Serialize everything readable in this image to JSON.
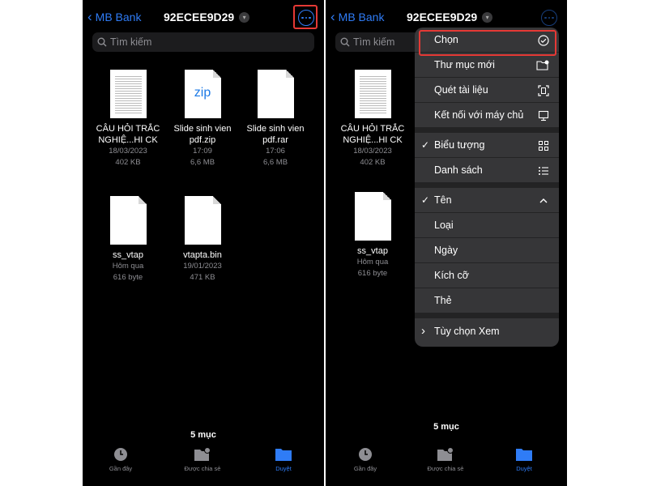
{
  "colors": {
    "accent": "#2f7cf6",
    "highlight": "#e53935",
    "background": "#000000"
  },
  "nav": {
    "back_label": "MB Bank",
    "title": "92ECEE9D29"
  },
  "search": {
    "placeholder": "Tìm kiếm"
  },
  "files": [
    {
      "name1": "CÂU HỎI TRẮC",
      "name2": "NGHIỆ...HI CK",
      "date": "18/03/2023",
      "size": "402 KB",
      "icon": "document-thumbnail"
    },
    {
      "name1": "Slide sinh vien",
      "name2": "pdf.zip",
      "date": "17:09",
      "size": "6,6 MB",
      "icon": "zip-icon",
      "label": "zip"
    },
    {
      "name1": "Slide sinh vien",
      "name2": "pdf.rar",
      "date": "17:06",
      "size": "6,6 MB",
      "icon": "blank-file-icon"
    },
    {
      "name1": "ss_vtap",
      "name2": "",
      "date": "Hôm qua",
      "size": "616 byte",
      "icon": "blank-file-icon"
    },
    {
      "name1": "vtapta.bin",
      "name2": "",
      "date": "19/01/2023",
      "size": "471 KB",
      "icon": "blank-file-icon"
    }
  ],
  "item_count": "5 mục",
  "tabs": [
    {
      "label": "Gần đây",
      "icon": "clock-icon"
    },
    {
      "label": "Được chia sẻ",
      "icon": "shared-folder-icon"
    },
    {
      "label": "Duyệt",
      "icon": "folder-icon"
    }
  ],
  "menu": {
    "items": [
      {
        "label": "Chọn",
        "icon": "checkmark-circle-icon",
        "checked": false
      },
      {
        "label": "Thư mục mới",
        "icon": "new-folder-icon",
        "checked": false
      },
      {
        "label": "Quét tài liệu",
        "icon": "scan-document-icon",
        "checked": false
      },
      {
        "label": "Kết nối với máy chủ",
        "icon": "monitor-icon",
        "checked": false
      },
      {
        "label": "Biểu tượng",
        "icon": "grid-icon",
        "checked": true
      },
      {
        "label": "Danh sách",
        "icon": "list-icon",
        "checked": false
      },
      {
        "label": "Tên",
        "icon": "chevron-up-icon",
        "checked": true
      },
      {
        "label": "Loại",
        "checked": false
      },
      {
        "label": "Ngày",
        "checked": false
      },
      {
        "label": "Kích cỡ",
        "checked": false
      },
      {
        "label": "Thẻ",
        "checked": false
      },
      {
        "label": "Tùy chọn Xem",
        "icon": "chevron-right-icon",
        "checked": false
      }
    ],
    "check_glyph": "✓",
    "expand_glyph": "›"
  }
}
